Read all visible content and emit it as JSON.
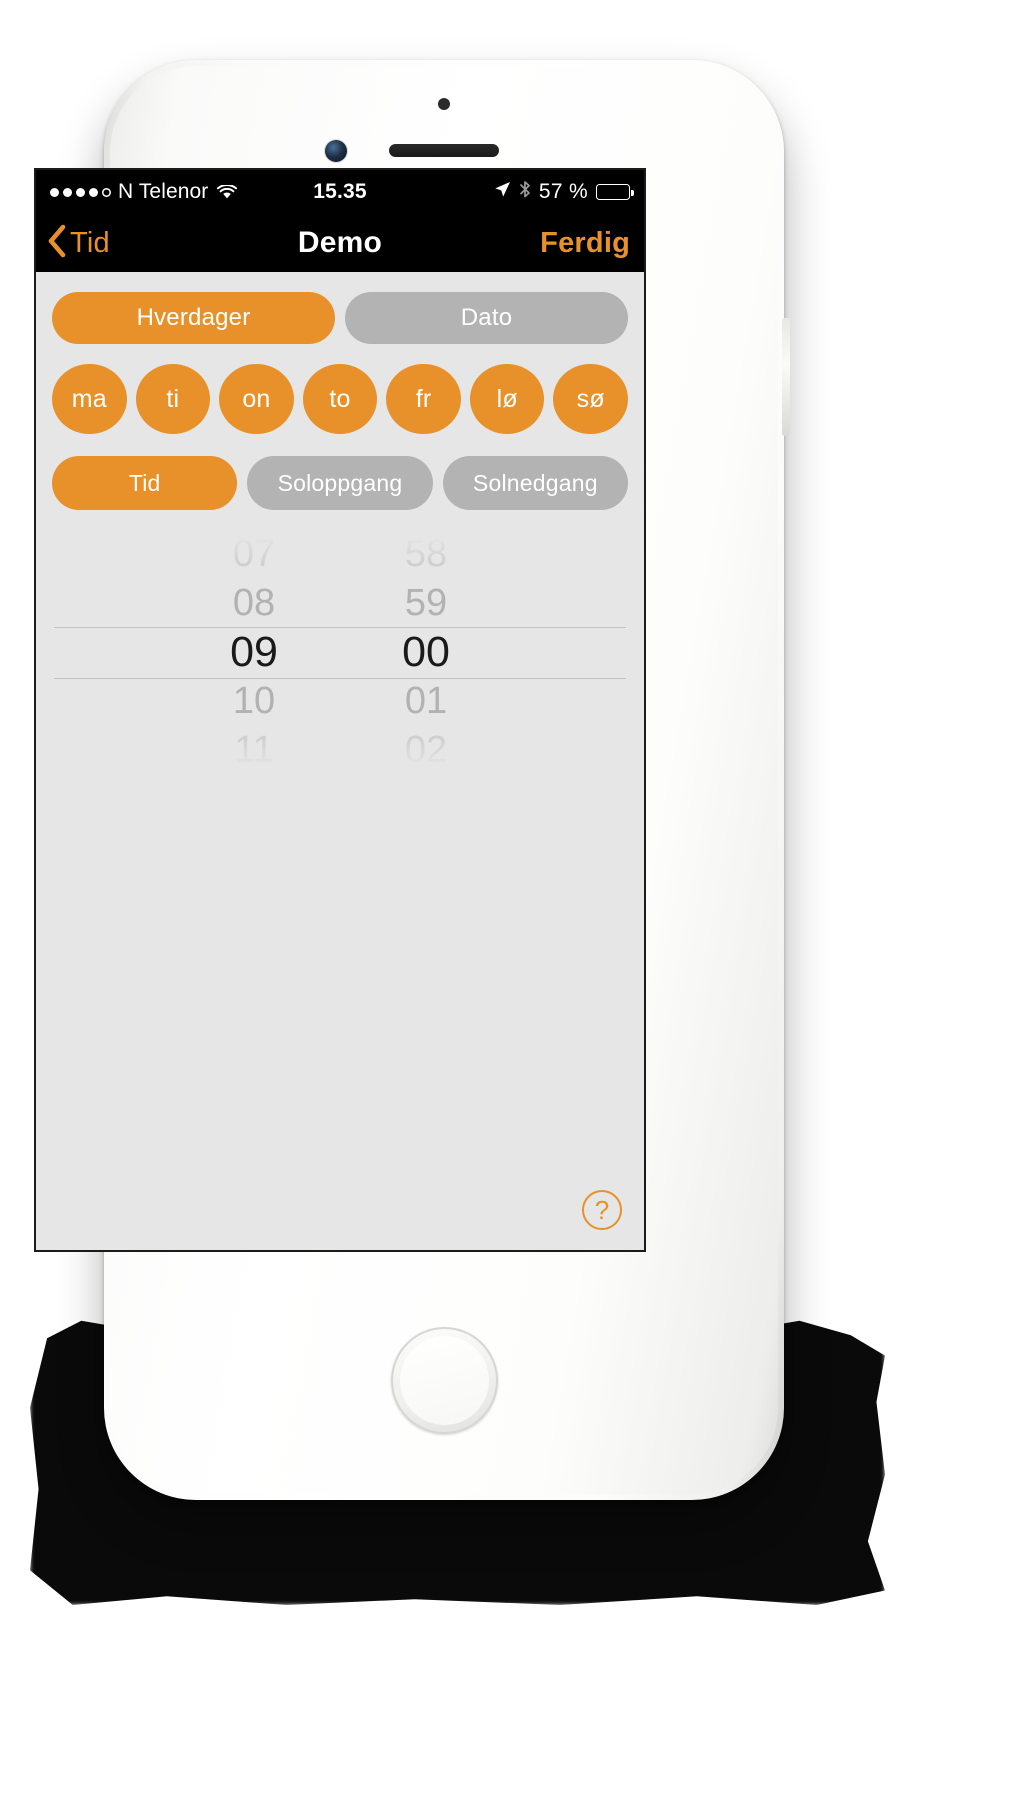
{
  "status_bar": {
    "signal_dots_filled": 4,
    "signal_dots_total": 5,
    "carrier": "N Telenor",
    "wifi_icon": "wifi-icon",
    "time": "15.35",
    "location_icon": "location-arrow-icon",
    "bluetooth_icon": "bluetooth-icon",
    "battery_text": "57 %",
    "battery_percent": 57
  },
  "nav_bar": {
    "back_icon": "chevron-left-icon",
    "back_label": "Tid",
    "title": "Demo",
    "done_label": "Ferdig"
  },
  "mode_segment": {
    "options": [
      {
        "label": "Hverdager",
        "active": true
      },
      {
        "label": "Dato",
        "active": false
      }
    ]
  },
  "weekdays": [
    {
      "label": "ma",
      "selected": true
    },
    {
      "label": "ti",
      "selected": true
    },
    {
      "label": "on",
      "selected": true
    },
    {
      "label": "to",
      "selected": true
    },
    {
      "label": "fr",
      "selected": true
    },
    {
      "label": "lø",
      "selected": true
    },
    {
      "label": "sø",
      "selected": true
    }
  ],
  "source_segment": {
    "options": [
      {
        "label": "Tid",
        "active": true
      },
      {
        "label": "Soloppgang",
        "active": false
      },
      {
        "label": "Solnedgang",
        "active": false
      }
    ]
  },
  "time_picker": {
    "hours": [
      "07",
      "08",
      "09",
      "10",
      "11"
    ],
    "minutes": [
      "58",
      "59",
      "00",
      "01",
      "02"
    ],
    "selected_index": 2,
    "selected_hour": "09",
    "selected_minute": "00"
  },
  "help_button": {
    "icon": "question-mark-icon",
    "label": "?"
  },
  "colors": {
    "accent": "#e8912a",
    "inactive": "#b3b3b3",
    "screen_bg": "#e6e6e6",
    "bar_bg": "#000000"
  }
}
